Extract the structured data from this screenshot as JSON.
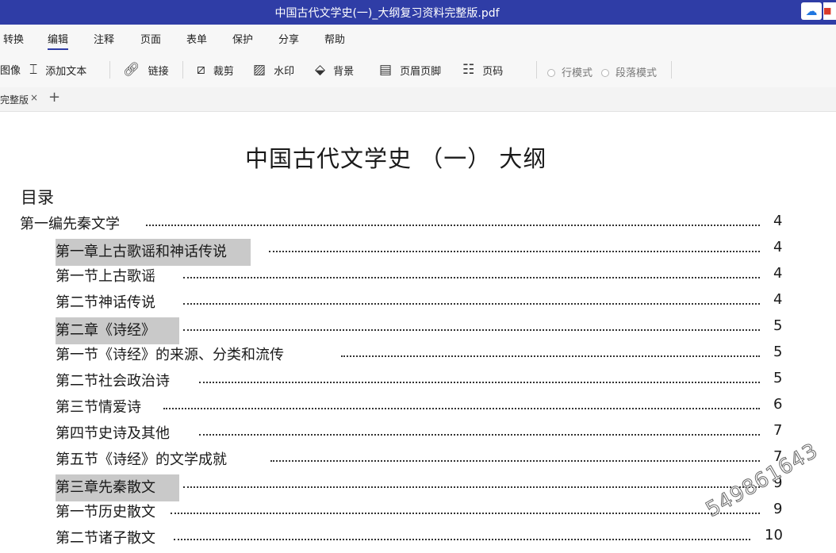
{
  "window": {
    "title": "中国古代文学史(一)_大纲复习资料完整版.pdf"
  },
  "menu": [
    "转换",
    "编辑",
    "注释",
    "页面",
    "表单",
    "保护",
    "分享",
    "帮助"
  ],
  "toolbar": {
    "image": "图像",
    "add_text": "添加文本",
    "link": "链接",
    "crop": "裁剪",
    "watermark": "水印",
    "background": "背景",
    "header_footer": "页眉页脚",
    "page_number": "页码",
    "line_mode": "行模式",
    "paragraph_mode": "段落模式"
  },
  "tab": {
    "label": "完整版",
    "close": "×",
    "add": "+"
  },
  "document": {
    "title": "中国古代文学史 （一） 大纲",
    "toc_heading": "目录",
    "entries": [
      {
        "label": "第一编先秦文学",
        "page": "4",
        "level": 1,
        "highlight": false
      },
      {
        "label": "第一章上古歌谣和神话传说",
        "page": "4",
        "level": 2,
        "highlight": true
      },
      {
        "label": "第一节上古歌谣",
        "page": "4",
        "level": 2,
        "highlight": false
      },
      {
        "label": "第二节神话传说",
        "page": "4",
        "level": 2,
        "highlight": false
      },
      {
        "label": "第二章《诗经》",
        "page": "5",
        "level": 2,
        "highlight": true
      },
      {
        "label": "第一节《诗经》的来源、分类和流传",
        "page": "5",
        "level": 2,
        "highlight": false
      },
      {
        "label": "第二节社会政治诗",
        "page": "5",
        "level": 2,
        "highlight": false
      },
      {
        "label": "第三节情爱诗",
        "page": "6",
        "level": 2,
        "highlight": false
      },
      {
        "label": "第四节史诗及其他",
        "page": "7",
        "level": 2,
        "highlight": false
      },
      {
        "label": "第五节《诗经》的文学成就",
        "page": "7",
        "level": 2,
        "highlight": false
      },
      {
        "label": "第三章先秦散文",
        "page": "9",
        "level": 2,
        "highlight": true
      },
      {
        "label": "第一节历史散文",
        "page": "9",
        "level": 2,
        "highlight": false
      },
      {
        "label": "第二节诸子散文",
        "page": "10",
        "level": 2,
        "highlight": false
      }
    ]
  },
  "watermark": "549861643"
}
